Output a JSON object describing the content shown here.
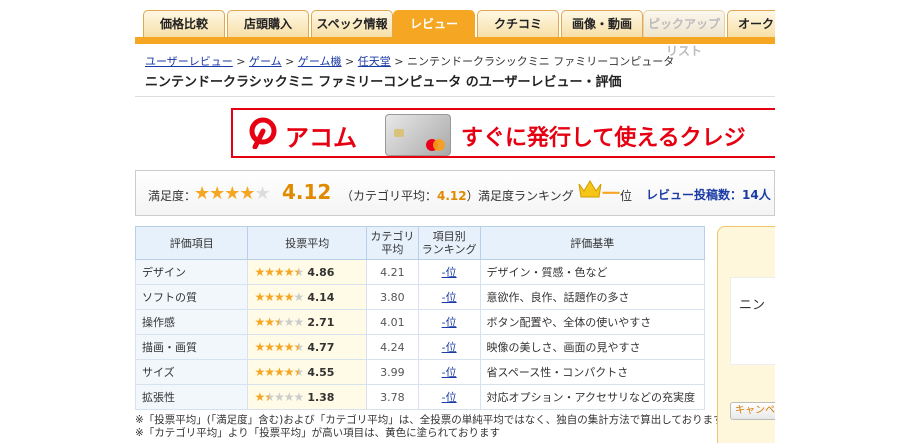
{
  "tabs": [
    {
      "label": "価格比較",
      "state": "normal"
    },
    {
      "label": "店頭購入",
      "state": "normal"
    },
    {
      "label": "スペック情報",
      "state": "normal"
    },
    {
      "label": "レビュー",
      "state": "active"
    },
    {
      "label": "クチコミ",
      "state": "normal"
    },
    {
      "label": "画像・動画",
      "state": "normal"
    },
    {
      "label": "ピックアップリスト",
      "state": "disabled"
    },
    {
      "label": "オークシ",
      "state": "normal"
    }
  ],
  "breadcrumb": {
    "items": [
      "ユーザーレビュー",
      "ゲーム",
      "ゲーム機",
      "任天堂"
    ],
    "sep": " > ",
    "current": "ニンテンドークラシックミニ ファミリーコンピュータ"
  },
  "page_title": "ニンテンドークラシックミニ ファミリーコンピュータ のユーザーレビュー・評価",
  "banner": {
    "brand": "アコム",
    "text": "すぐに発行して使えるクレジ",
    "colors": {
      "brand": "#e60012"
    }
  },
  "summary": {
    "label": "満足度：",
    "stars_value": 4.12,
    "score": "4.12",
    "category_avg_prefix": "（カテゴリ平均：",
    "category_avg": "4.12",
    "category_avg_suffix": "）",
    "ranking_label": "満足度ランキング",
    "ranking_value": "一",
    "ranking_unit": "位",
    "review_count": "レビュー投稿数：14人"
  },
  "table": {
    "headers": [
      "評価項目",
      "投票平均",
      "カテゴリ平均",
      "項目別ランキング",
      "評価基準"
    ],
    "rows": [
      {
        "item": "デザイン",
        "stars": 4.86,
        "avg": "4.86",
        "cat": "4.21",
        "rank": "-位",
        "crit": "デザイン・質感・色など"
      },
      {
        "item": "ソフトの質",
        "stars": 4.14,
        "avg": "4.14",
        "cat": "3.80",
        "rank": "-位",
        "crit": "意欲作、良作、話題作の多さ"
      },
      {
        "item": "操作感",
        "stars": 2.71,
        "avg": "2.71",
        "cat": "4.01",
        "rank": "-位",
        "crit": "ボタン配置や、全体の使いやすさ"
      },
      {
        "item": "描画・画質",
        "stars": 4.77,
        "avg": "4.77",
        "cat": "4.24",
        "rank": "-位",
        "crit": "映像の美しさ、画面の見やすさ"
      },
      {
        "item": "サイズ",
        "stars": 4.55,
        "avg": "4.55",
        "cat": "3.99",
        "rank": "-位",
        "crit": "省スペース性・コンパクトさ"
      },
      {
        "item": "拡張性",
        "stars": 1.38,
        "avg": "1.38",
        "cat": "3.78",
        "rank": "-位",
        "crit": "対応オプション・アクセサリなどの充実度"
      }
    ]
  },
  "notes": [
    "※「投票平均」(「満足度」含む)および「カテゴリ平均」は、全投票の単純平均ではなく、独自の集計方法で算出しております",
    "※「カテゴリ平均」より「投票平均」が高い項目は、黄色に塗られております"
  ],
  "side": {
    "text": "ニン",
    "button": "キャンペー"
  },
  "colors": {
    "accent": "#f5a623",
    "link": "#1a3aa5",
    "highlight": "#fffbe6",
    "header_bg": "#e6f1fb"
  }
}
